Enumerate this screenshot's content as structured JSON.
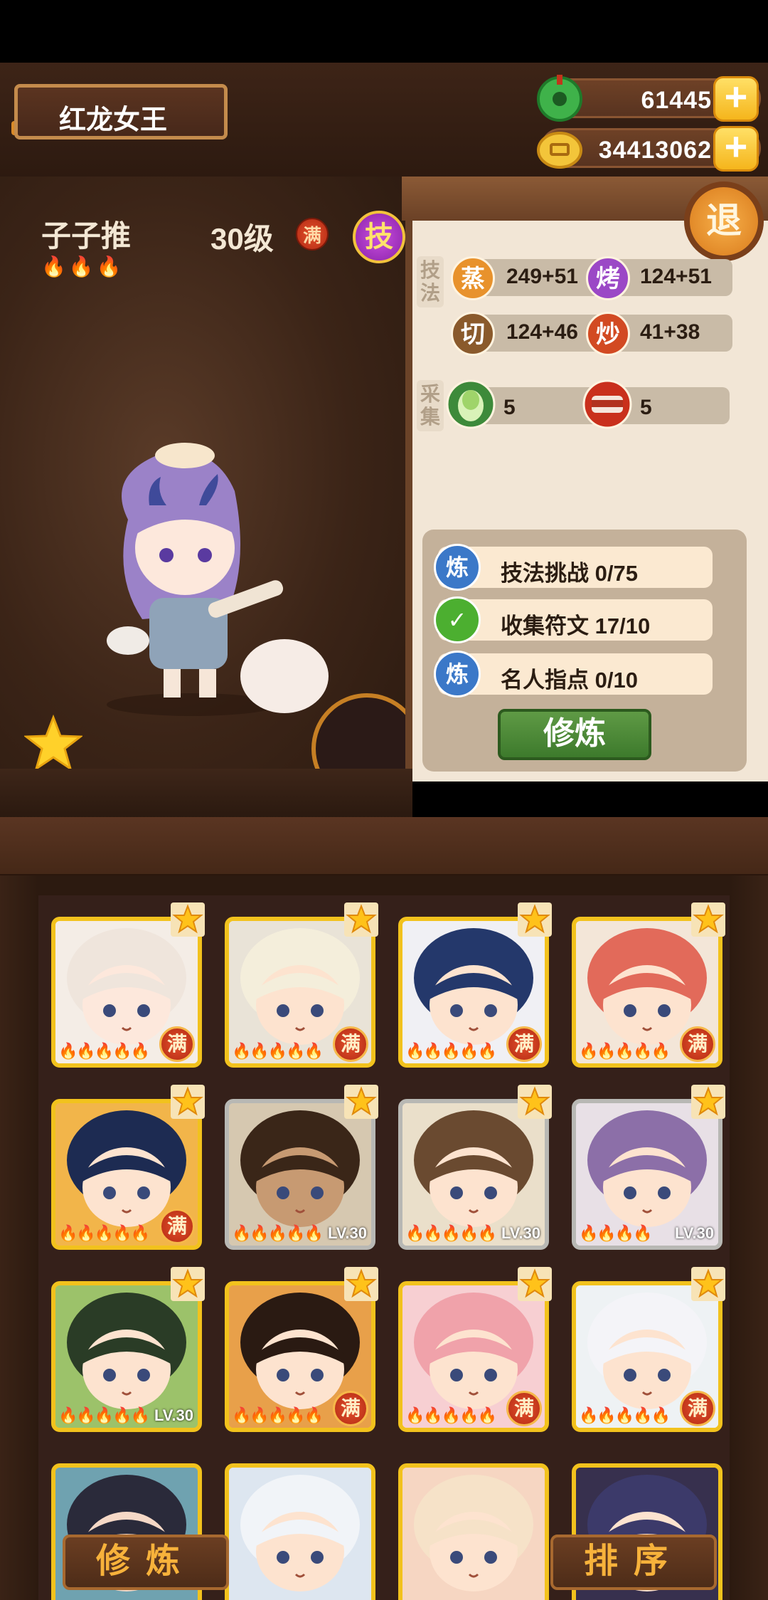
{
  "header": {
    "title": "红龙女王",
    "currency_jade": "61445",
    "currency_coin": "34413062",
    "jade_icon": "jade-coin-icon",
    "gold_icon": "gold-coin-icon",
    "plus": "+"
  },
  "hero": {
    "name": "子子推",
    "level": "30级",
    "max_badge": "满",
    "skill_button": "技",
    "flames": "🔥🔥🔥"
  },
  "panel": {
    "exit_label": "退",
    "skills_label": "技法",
    "gather_label": "采集",
    "stats": [
      {
        "icon_text": "蒸",
        "value": "249+51",
        "color": "#e8922c"
      },
      {
        "icon_text": "烤",
        "value": "124+51",
        "color": "#9b48c6"
      },
      {
        "icon_text": "切",
        "value": "124+46",
        "color": "#8a5a2c"
      },
      {
        "icon_text": "炒",
        "value": "41+38",
        "color": "#d24a22"
      }
    ],
    "gather": [
      {
        "icon": "cabbage-icon",
        "value": "5"
      },
      {
        "icon": "meat-icon",
        "value": "5"
      }
    ],
    "training": [
      {
        "icon_text": "炼",
        "text": "技法挑战 0/75",
        "status": "pending"
      },
      {
        "icon_text": "✓",
        "text": "收集符文 17/10",
        "status": "done"
      },
      {
        "icon_text": "炼",
        "text": "名人指点 0/10",
        "status": "pending"
      }
    ],
    "train_button": "修炼"
  },
  "grid": {
    "cards": [
      {
        "frame": "gold",
        "badge": "满",
        "lv": "",
        "flames": "🔥🔥🔥🔥🔥",
        "bg": "#f4ede6",
        "hair": "#efe5dc",
        "skin": "#fde8dc"
      },
      {
        "frame": "gold",
        "badge": "满",
        "lv": "",
        "flames": "🔥🔥🔥🔥🔥",
        "bg": "#e9e3d7",
        "hair": "#f4eedb",
        "skin": "#fde3cf"
      },
      {
        "frame": "gold",
        "badge": "满",
        "lv": "",
        "flames": "🔥🔥🔥🔥🔥",
        "bg": "#f0f0f4",
        "hair": "#24386b",
        "skin": "#fde3cf"
      },
      {
        "frame": "gold",
        "badge": "满",
        "lv": "",
        "flames": "🔥🔥🔥🔥🔥",
        "bg": "#f3e6d8",
        "hair": "#e26a5a",
        "skin": "#fde3cf"
      },
      {
        "frame": "gold",
        "badge": "满",
        "lv": "",
        "flames": "🔥🔥🔥🔥🔥",
        "bg": "#f2b54a",
        "hair": "#1d2b52",
        "skin": "#fde3cf"
      },
      {
        "frame": "silver",
        "badge": "",
        "lv": "LV.30",
        "flames": "🔥🔥🔥🔥🔥",
        "bg": "#d6c8b0",
        "hair": "#3a2618",
        "skin": "#c79a72"
      },
      {
        "frame": "silver",
        "badge": "",
        "lv": "LV.30",
        "flames": "🔥🔥🔥🔥🔥",
        "bg": "#eadfca",
        "hair": "#6a4a30",
        "skin": "#fde3cf"
      },
      {
        "frame": "silver",
        "badge": "",
        "lv": "LV.30",
        "flames": "🔥🔥🔥🔥",
        "bg": "#e8e0e6",
        "hair": "#8c6fa8",
        "skin": "#fde3cf"
      },
      {
        "frame": "gold",
        "badge": "",
        "lv": "LV.30",
        "flames": "🔥🔥🔥🔥🔥",
        "bg": "#9cc26a",
        "hair": "#2a3c26",
        "skin": "#fde3cf"
      },
      {
        "frame": "gold",
        "badge": "满",
        "lv": "",
        "flames": "🔥🔥🔥🔥🔥",
        "bg": "#e8a04a",
        "hair": "#2a1a12",
        "skin": "#fde3cf"
      },
      {
        "frame": "gold",
        "badge": "满",
        "lv": "",
        "flames": "🔥🔥🔥🔥🔥",
        "bg": "#f7cfd2",
        "hair": "#f0a2aa",
        "skin": "#fde3cf"
      },
      {
        "frame": "gold",
        "badge": "满",
        "lv": "",
        "flames": "🔥🔥🔥🔥🔥",
        "bg": "#eef2f4",
        "hair": "#f4f4f8",
        "skin": "#fde3cf"
      },
      {
        "frame": "gold",
        "badge": "",
        "lv": "",
        "flames": "",
        "bg": "#6fa2b0",
        "hair": "#2a2a3a",
        "skin": "#f5d8c6"
      },
      {
        "frame": "gold",
        "badge": "",
        "lv": "",
        "flames": "",
        "bg": "#dde6f0",
        "hair": "#f1f4f8",
        "skin": "#fde3cf"
      },
      {
        "frame": "gold",
        "badge": "",
        "lv": "",
        "flames": "",
        "bg": "#f6d6c2",
        "hair": "#f6e2c8",
        "skin": "#fde3cf"
      },
      {
        "frame": "gold",
        "badge": "",
        "lv": "",
        "flames": "",
        "bg": "#37304e",
        "hair": "#3c3a6a",
        "skin": "#fde3cf"
      }
    ]
  },
  "bottom": {
    "train": "修炼",
    "sort": "排序"
  }
}
